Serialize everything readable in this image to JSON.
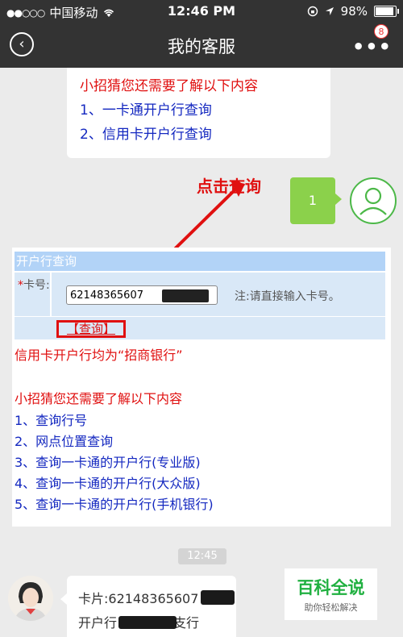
{
  "status_bar": {
    "signal_dots": "●●○○○",
    "carrier": "中国移动",
    "time": "12:46 PM",
    "battery": "98%"
  },
  "nav": {
    "title": "我的客服",
    "badge_count": "8",
    "back_icon": "back-circle-icon",
    "more_icon": "more-dots-icon"
  },
  "top_bubble": {
    "heading": "小招猜您还需要了解以下内容",
    "items": [
      "1、一卡通开户行查询",
      "2、信用卡开户行查询"
    ]
  },
  "annotation": {
    "label": "点击查询",
    "color": "#e01010"
  },
  "user_message": {
    "text": "1"
  },
  "lookup_panel": {
    "title": "开户行查询",
    "field_star": "*",
    "field_label": "卡号:",
    "card_value": "62148365607",
    "note": "注:请直接输入卡号。",
    "query_button": "【查询】",
    "credit_card_note": "信用卡开户行均为“招商银行”",
    "guess_heading": "小招猜您还需要了解以下内容",
    "guess_items": [
      "1、查询行号",
      "2、网点位置查询",
      "3、查询一卡通的开户行(专业版)",
      "4、查询一卡通的开户行(大众版)",
      "5、查询一卡通的开户行(手机银行)"
    ]
  },
  "timestamp": "12:45",
  "agent_message": {
    "line1": "卡片:62148365607",
    "line2_prefix": "开户行",
    "line2_suffix": "支行"
  },
  "watermark": {
    "title": "百科全说",
    "subtitle": "助你轻松解决"
  },
  "colors": {
    "bar": "#333333",
    "background": "#ebebeb",
    "user_bubble": "#8bd14b",
    "panel_header": "#b2d3f7",
    "panel_row": "#d9e8f7",
    "red": "#e01010",
    "blue": "#1428c0"
  }
}
